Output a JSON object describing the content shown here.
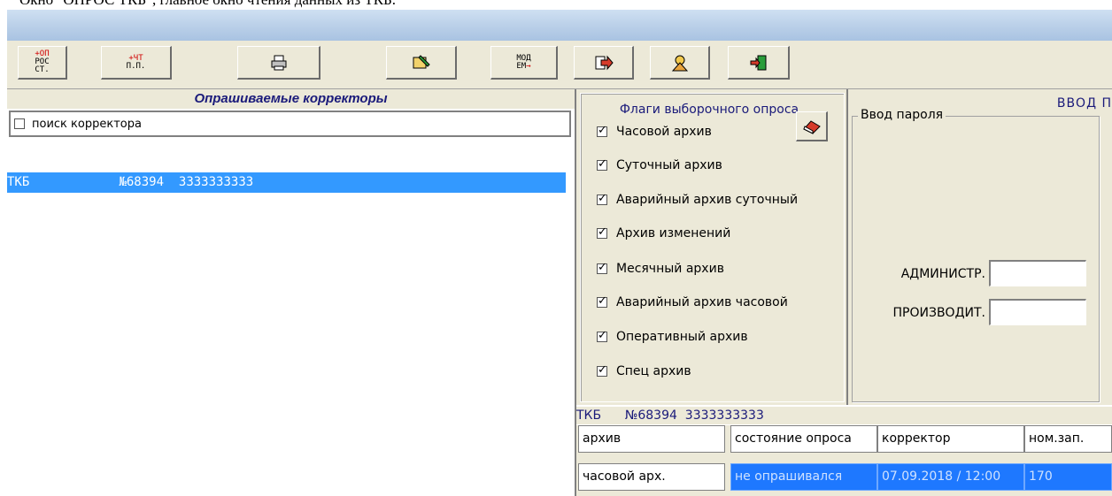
{
  "caption": "Окно \"ОПРОС ТКБ\", главное окно чтения данных из ТКБ.",
  "toolbar": {
    "btn1_line1": "+ОП",
    "btn1_line2": "РОС",
    "btn1_line3": "СТ.",
    "btn2_line1": "+ЧТ",
    "btn2_line2": "П.П.",
    "btn5_line1": "МОД",
    "btn5_line2": "ЕМ"
  },
  "left": {
    "title": "Опрашиваемые корректоры",
    "search_label": "поиск корректора",
    "row_name": "ТКБ",
    "row_num": "№68394",
    "row_phone": "3333333333"
  },
  "flags": {
    "title": "Флаги выборочного опроса",
    "items": [
      {
        "label": "Часовой архив",
        "checked": true
      },
      {
        "label": "Суточный архив",
        "checked": true
      },
      {
        "label": "Аварийный архив суточный",
        "checked": true
      },
      {
        "label": "Архив изменений",
        "checked": true
      },
      {
        "label": "Месячный архив",
        "checked": true
      },
      {
        "label": "Аварийный архив часовой",
        "checked": true
      },
      {
        "label": "Оперативный архив",
        "checked": true
      },
      {
        "label": "Спец архив",
        "checked": true
      }
    ]
  },
  "right": {
    "title": "ВВОД П",
    "group_label": "Ввод пароля",
    "admin_label": "АДМИНИСТР.",
    "admin_value": "",
    "prod_label": "ПРОИЗВОДИТ.",
    "prod_value": ""
  },
  "info_line": "ТКБ      №68394  3333333333",
  "grid": {
    "headers": [
      "архив",
      "состояние опроса",
      "корректор",
      "ном.зап."
    ],
    "row": [
      "часовой арх.",
      "не опрашивался",
      "07.09.2018 / 12:00",
      "170"
    ]
  }
}
